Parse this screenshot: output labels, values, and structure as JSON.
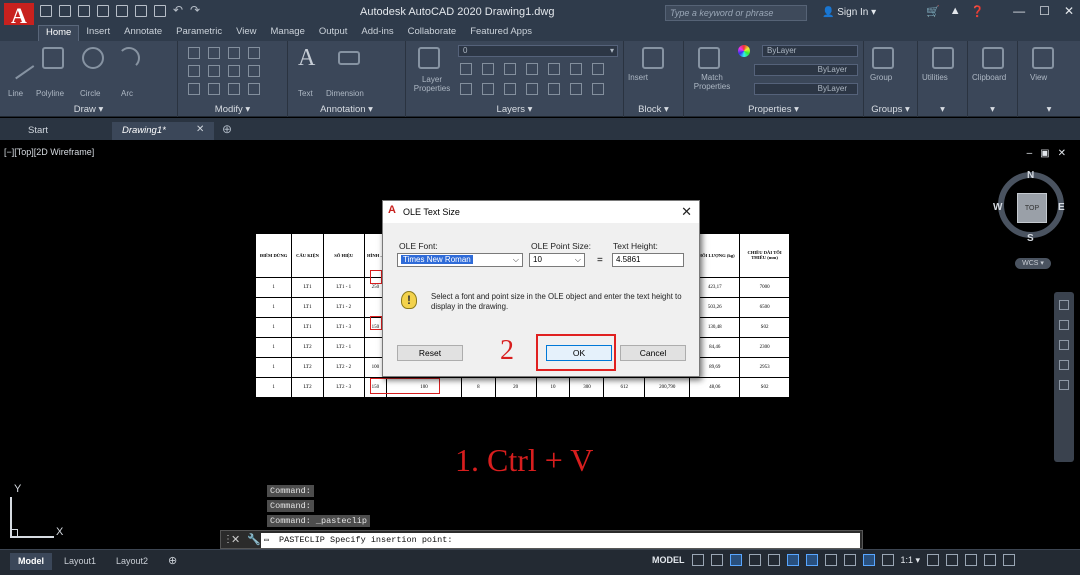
{
  "app": {
    "title": "Autodesk AutoCAD 2020    Drawing1.dwg",
    "logo": "A",
    "search_placeholder": "Type a keyword or phrase",
    "sign_in": "Sign In"
  },
  "ribbon_tabs": [
    "Home",
    "Insert",
    "Annotate",
    "Parametric",
    "View",
    "Manage",
    "Output",
    "Add-ins",
    "Collaborate",
    "Featured Apps"
  ],
  "active_ribbon_tab": "Home",
  "panels": {
    "draw": {
      "label": "Draw ▾",
      "tools": [
        "Line",
        "Polyline",
        "Circle",
        "Arc"
      ]
    },
    "modify": {
      "label": "Modify ▾"
    },
    "annotation": {
      "label": "Annotation ▾",
      "tools": [
        "Text",
        "Dimension"
      ]
    },
    "layers": {
      "label": "Layers ▾",
      "tools": [
        "Layer Properties"
      ],
      "layer_value": "0"
    },
    "block": {
      "label": "Block ▾",
      "tools": [
        "Insert"
      ]
    },
    "properties": {
      "label": "Properties ▾",
      "tools": [
        "Match Properties"
      ],
      "color": "ByLayer",
      "linetype": "ByLayer",
      "lineweight": "ByLayer"
    },
    "groups": {
      "label": "Groups ▾",
      "tools": [
        "Group"
      ]
    },
    "utilities": {
      "label": "Utilities"
    },
    "clipboard": {
      "label": "Clipboard"
    },
    "view": {
      "label": "View"
    }
  },
  "doc_tabs": {
    "start": "Start",
    "drawing": "Drawing1*"
  },
  "viewport": {
    "label": "[−][Top][2D Wireframe]",
    "viewcube": {
      "n": "N",
      "s": "S",
      "w": "W",
      "e": "E",
      "face": "TOP",
      "wcs": "WCS ▾"
    }
  },
  "spreadsheet": {
    "headers": [
      "ĐIỂM DỪNG",
      "CẤU KIỆN",
      "SỐ HIỆU",
      "HÌNH ...",
      "...",
      "...",
      "...",
      "...",
      "...",
      "...",
      "...",
      "KHỐI LƯỢNG (kg)",
      "CHIỀU DÀI TỐI THIỂU (mm)"
    ],
    "rows": [
      [
        "1",
        "LT1",
        "LT1 - 1",
        "250",
        "",
        "",
        "",
        "",
        "",
        "",
        "",
        "423,17",
        "7000"
      ],
      [
        "1",
        "LT1",
        "LT1 - 2",
        "",
        "",
        "",
        "",
        "",
        "",
        "",
        "",
        "503,26",
        "6500"
      ],
      [
        "1",
        "LT1",
        "LT1 - 3",
        "150",
        "",
        "",
        "",
        "",
        "",
        "",
        "",
        "130,48",
        "S02"
      ],
      [
        "1",
        "LT2",
        "LT2 - 1",
        "",
        "",
        "",
        "",
        "",
        "",
        "",
        "",
        "84,46",
        "2300"
      ],
      [
        "1",
        "LT2",
        "LT2 - 2",
        "100",
        "",
        "",
        "",
        "",
        "",
        "",
        "",
        "89,69",
        "2953"
      ],
      [
        "1",
        "LT2",
        "LT2 - 3",
        "150",
        "100",
        "8",
        "20",
        "10",
        "300",
        "612",
        "200,790",
        "0,021",
        "48,06",
        "S02"
      ]
    ]
  },
  "dialog": {
    "title": "OLE Text Size",
    "font_label": "OLE Font:",
    "font_value": "Times New Roman",
    "point_label": "OLE Point Size:",
    "point_value": "10",
    "equals": "=",
    "height_label": "Text Height:",
    "height_value": "4.5861",
    "message": "Select a font and point size in the OLE object and enter the text height to display in the drawing.",
    "reset": "Reset",
    "ok": "OK",
    "cancel": "Cancel"
  },
  "annotations": {
    "step2": "2",
    "step1": "1. Ctrl + V"
  },
  "ucs": {
    "x": "X",
    "y": "Y"
  },
  "command_history": [
    "Command:",
    "Command:",
    "Command:  _pasteclip"
  ],
  "command_line": "PASTECLIP Specify insertion point:",
  "status": {
    "model_tab": "Model",
    "layout1": "Layout1",
    "layout2": "Layout2",
    "model_btn": "MODEL",
    "scale": "1:1 ▾"
  }
}
